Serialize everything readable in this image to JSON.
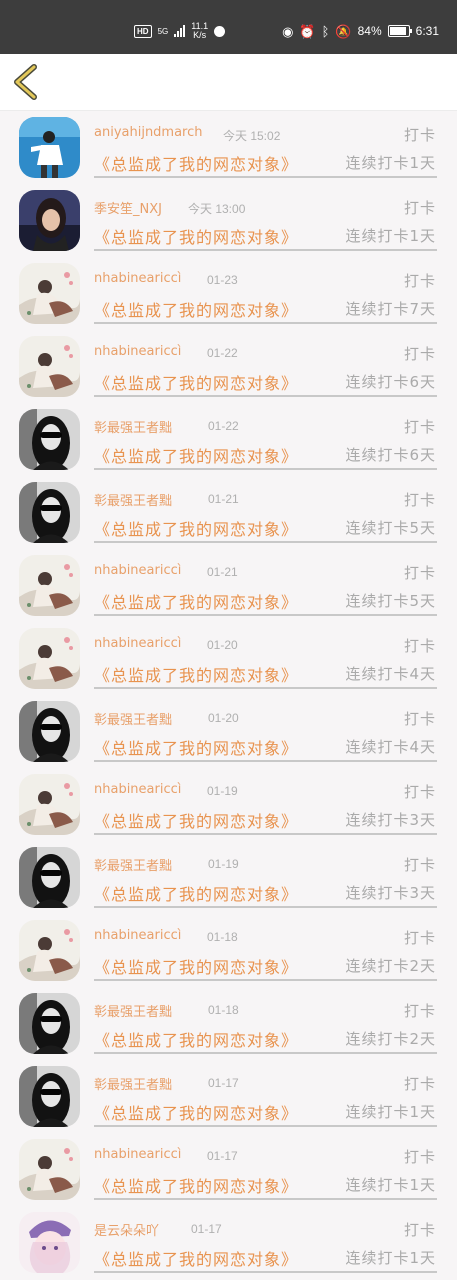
{
  "status_bar": {
    "network": "HD",
    "signal": "5G",
    "speed_value": "11.1",
    "speed_unit": "K/s",
    "battery": "84%",
    "time": "6:31"
  },
  "nav": {
    "back_icon": "chevron-left-icon"
  },
  "colors": {
    "accent": "#e8934f",
    "muted": "#aaaaaa"
  },
  "entries": [
    {
      "name": "aniyahijndmarch",
      "time": "今天 15:02",
      "action": "打卡",
      "title": "《总监成了我的网恋对象》",
      "streak": "连续打卡1天",
      "avatar": "blue"
    },
    {
      "name": "季安笙_NXJ",
      "time": "今天 13:00",
      "action": "打卡",
      "title": "《总监成了我的网恋对象》",
      "streak": "连续打卡1天",
      "avatar": "dark"
    },
    {
      "name": "nhabineariccì",
      "time": "01-23",
      "action": "打卡",
      "title": "《总监成了我的网恋对象》",
      "streak": "连续打卡7天",
      "avatar": "art"
    },
    {
      "name": "nhabineariccì",
      "time": "01-22",
      "action": "打卡",
      "title": "《总监成了我的网恋对象》",
      "streak": "连续打卡6天",
      "avatar": "art"
    },
    {
      "name": "彰最强王者黜",
      "time": "01-22",
      "action": "打卡",
      "title": "《总监成了我的网恋对象》",
      "streak": "连续打卡6天",
      "avatar": "bw"
    },
    {
      "name": "彰最强王者黜",
      "time": "01-21",
      "action": "打卡",
      "title": "《总监成了我的网恋对象》",
      "streak": "连续打卡5天",
      "avatar": "bw"
    },
    {
      "name": "nhabineariccì",
      "time": "01-21",
      "action": "打卡",
      "title": "《总监成了我的网恋对象》",
      "streak": "连续打卡5天",
      "avatar": "art"
    },
    {
      "name": "nhabineariccì",
      "time": "01-20",
      "action": "打卡",
      "title": "《总监成了我的网恋对象》",
      "streak": "连续打卡4天",
      "avatar": "art"
    },
    {
      "name": "彰最强王者黜",
      "time": "01-20",
      "action": "打卡",
      "title": "《总监成了我的网恋对象》",
      "streak": "连续打卡4天",
      "avatar": "bw"
    },
    {
      "name": "nhabineariccì",
      "time": "01-19",
      "action": "打卡",
      "title": "《总监成了我的网恋对象》",
      "streak": "连续打卡3天",
      "avatar": "art"
    },
    {
      "name": "彰最强王者黜",
      "time": "01-19",
      "action": "打卡",
      "title": "《总监成了我的网恋对象》",
      "streak": "连续打卡3天",
      "avatar": "bw"
    },
    {
      "name": "nhabineariccì",
      "time": "01-18",
      "action": "打卡",
      "title": "《总监成了我的网恋对象》",
      "streak": "连续打卡2天",
      "avatar": "art"
    },
    {
      "name": "彰最强王者黜",
      "time": "01-18",
      "action": "打卡",
      "title": "《总监成了我的网恋对象》",
      "streak": "连续打卡2天",
      "avatar": "bw"
    },
    {
      "name": "彰最强王者黜",
      "time": "01-17",
      "action": "打卡",
      "title": "《总监成了我的网恋对象》",
      "streak": "连续打卡1天",
      "avatar": "bw"
    },
    {
      "name": "nhabineariccì",
      "time": "01-17",
      "action": "打卡",
      "title": "《总监成了我的网恋对象》",
      "streak": "连续打卡1天",
      "avatar": "art"
    },
    {
      "name": "是云朵朵吖",
      "time": "01-17",
      "action": "打卡",
      "title": "《总监成了我的网恋对象》",
      "streak": "连续打卡1天",
      "avatar": "anime"
    }
  ]
}
